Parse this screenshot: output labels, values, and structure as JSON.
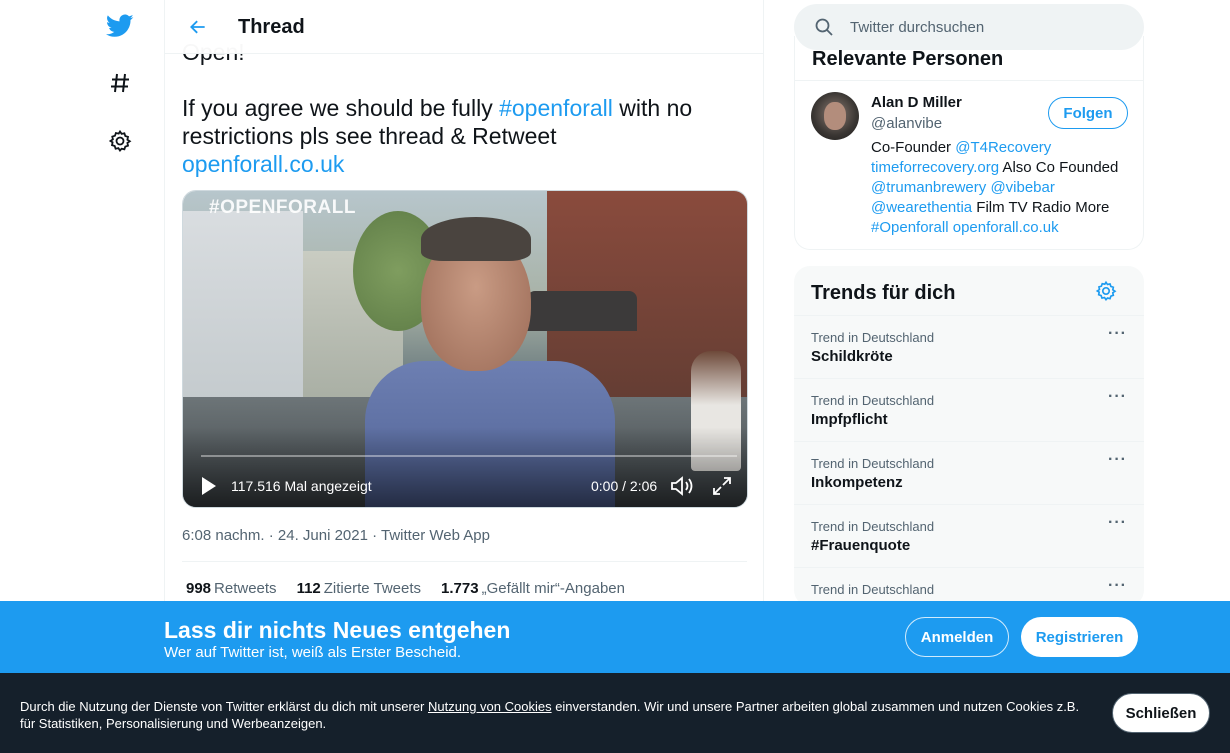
{
  "colors": {
    "brand": "#1d9bf0",
    "text": "#0f1419",
    "muted": "#536471",
    "cookie_bg": "#15202b"
  },
  "nav": {
    "items": [
      {
        "icon": "twitter-logo-icon"
      },
      {
        "icon": "hashtag-explore-icon"
      },
      {
        "icon": "gear-settings-icon"
      }
    ]
  },
  "header": {
    "title": "Thread"
  },
  "tweet": {
    "text_top": "Open!",
    "text_line1_a": "If you agree we should be fully ",
    "text_line1_hashtag": "#openforall",
    "text_line1_b": " with no",
    "text_line2": "restrictions pls see thread & Retweet",
    "text_link": "openforall.co.uk",
    "video": {
      "watermark": "#OPENFORALL",
      "views": "117.516 Mal angezeigt",
      "time": "0:00 / 2:06"
    },
    "meta": "6:08 nachm. · 24. Juni 2021 · Twitter Web App",
    "stats": [
      {
        "count": "998",
        "label": "Retweets"
      },
      {
        "count": "112",
        "label": "Zitierte Tweets"
      },
      {
        "count": "1.773",
        "label": "„Gefällt mir“-Angaben"
      }
    ]
  },
  "search": {
    "placeholder": "Twitter durchsuchen"
  },
  "people": {
    "title": "Relevante Personen",
    "person": {
      "name": "Alan D Miller",
      "handle": "@alanvibe",
      "follow_label": "Folgen",
      "bio": [
        {
          "text": "Co-Founder ",
          "link": false
        },
        {
          "text": "@T4Recovery",
          "link": true
        },
        {
          "text": " ",
          "link": false
        },
        {
          "text": "timeforrecovery.org",
          "link": true
        },
        {
          "text": " Also Co Founded ",
          "link": false
        },
        {
          "text": "@trumanbrewery",
          "link": true
        },
        {
          "text": " ",
          "link": false
        },
        {
          "text": "@vibebar",
          "link": true
        },
        {
          "text": " ",
          "link": false
        },
        {
          "text": "@wearethentia",
          "link": true
        },
        {
          "text": " Film TV Radio More ",
          "link": false
        },
        {
          "text": "#Openforall",
          "link": true
        },
        {
          "text": " ",
          "link": false
        },
        {
          "text": "openforall.co.uk",
          "link": true
        }
      ]
    }
  },
  "trends": {
    "title": "Trends für dich",
    "items": [
      {
        "meta": "Trend in Deutschland",
        "name": "Schildkröte"
      },
      {
        "meta": "Trend in Deutschland",
        "name": "Impfpflicht"
      },
      {
        "meta": "Trend in Deutschland",
        "name": "Inkompetenz"
      },
      {
        "meta": "Trend in Deutschland",
        "name": "#Frauenquote"
      },
      {
        "meta": "Trend in Deutschland",
        "name": ""
      }
    ]
  },
  "signup": {
    "title": "Lass dir nichts Neues entgehen",
    "subtitle": "Wer auf Twitter ist, weiß als Erster Bescheid.",
    "login_label": "Anmelden",
    "register_label": "Registrieren"
  },
  "cookie": {
    "text_before": "Durch die Nutzung der Dienste von Twitter erklärst du dich mit unserer ",
    "link_text": "Nutzung von Cookies",
    "text_after": " einverstanden. Wir und unsere Partner arbeiten global zusammen und nutzen Cookies z.B. für Statistiken, Personalisierung und Werbeanzeigen.",
    "close_label": "Schließen"
  }
}
